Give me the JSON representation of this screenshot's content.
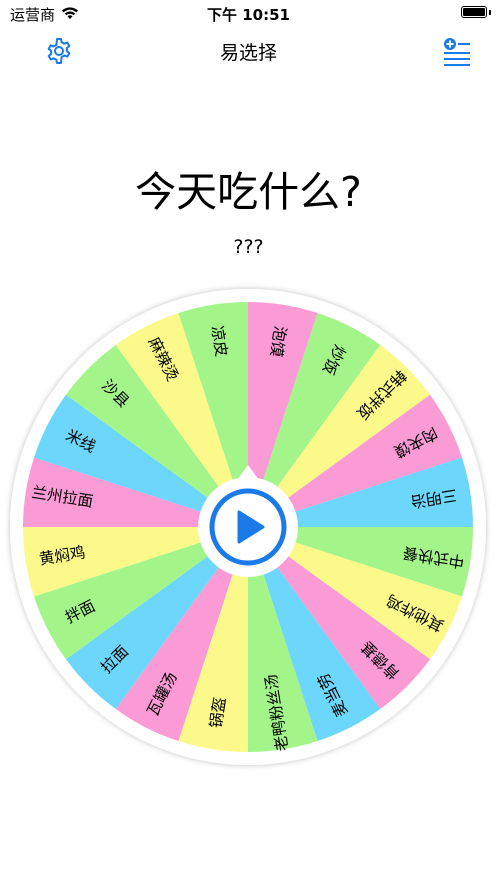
{
  "status_bar": {
    "carrier": "运营商",
    "time": "下午 10:51"
  },
  "nav": {
    "title": "易选择",
    "left_icon": "gear-icon",
    "right_icon": "add-list-icon",
    "accent_color": "#1a7be8"
  },
  "question": "今天吃什么?",
  "result": "???",
  "wheel": {
    "slice_colors": [
      "#fb9bd6",
      "#a3f58a",
      "#fbf98a",
      "#fb9bd6",
      "#6dd6fb",
      "#a3f58a",
      "#fbf98a",
      "#fb9bd6",
      "#6dd6fb",
      "#a3f58a",
      "#fbf98a",
      "#fb9bd6",
      "#6dd6fb",
      "#a3f58a",
      "#fbf98a",
      "#fb9bd6",
      "#6dd6fb",
      "#a3f58a",
      "#fbf98a",
      "#a3f58a"
    ],
    "items": [
      "泡馍",
      "炒饭",
      "韩式拌饭",
      "肉夹馍",
      "三明治",
      "中式快餐",
      "其他炸鸡",
      "肯德基",
      "麦当劳",
      "老鸭粉丝汤",
      "锅盔",
      "瓦罐汤",
      "拉面",
      "拌面",
      "黄焖鸡",
      "兰州拉面",
      "米线",
      "沙县",
      "麻辣烫",
      "凉皮"
    ],
    "center_button_icon": "play-icon",
    "pointer_color": "#ffffff"
  }
}
